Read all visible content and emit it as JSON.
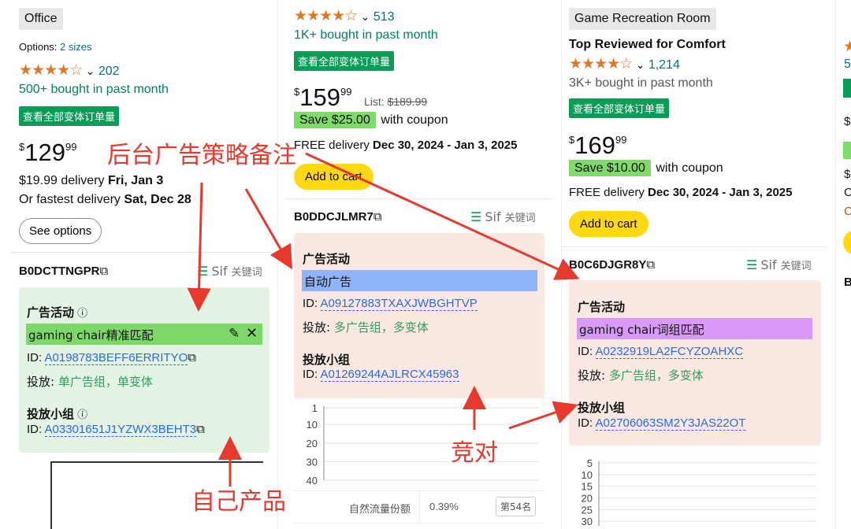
{
  "col1": {
    "category": "Office",
    "options_prefix": "Options:",
    "options_link": "2 sizes",
    "rating_count": "202",
    "bought": "500+ bought in past month",
    "variant_badge": "查看全部变体订单量",
    "price_sym": "$",
    "price_whole": "129",
    "price_frac": "99",
    "delivery_prefix": "$19.99 delivery",
    "delivery_date": "Fri, Jan 3",
    "fastest_prefix": "Or fastest delivery",
    "fastest_date": "Sat, Dec 28",
    "see_options": "See options",
    "asin": "B0DCTTNGPR",
    "sif_label": "Sif",
    "keyword_label": "关键词",
    "ad_activity_label": "广告活动",
    "campaign_name": "gaming chair精准匹配",
    "id_label": "ID:",
    "campaign_id": "A0198783BEFF6ERRITYO",
    "placement_label": "投放:",
    "placement_value": "单广告组，单变体",
    "ad_group_label": "投放小组",
    "ad_group_id": "A03301651J1YZWX3BEHT3"
  },
  "col2": {
    "rating_count": "513",
    "bought": "1K+ bought in past month",
    "variant_badge": "查看全部变体订单量",
    "price_sym": "$",
    "price_whole": "159",
    "price_frac": "99",
    "list_label": "List:",
    "list_price": "$189.99",
    "save_label": "Save $25.00",
    "coupon_text": "with coupon",
    "free_delivery": "FREE delivery",
    "delivery_range": "Dec 30, 2024 - Jan 3, 2025",
    "add_to_cart": "Add to cart",
    "asin": "B0DDCJLMR7",
    "sif_label": "Sif",
    "keyword_label": "关键词",
    "ad_activity_label": "广告活动",
    "campaign_name": "自动广告",
    "id_label": "ID:",
    "campaign_id": "A09127883TXAXJWBGHTVP",
    "placement_label": "投放:",
    "placement_value": "多广告组，多变体",
    "ad_group_label": "投放小组",
    "ad_group_id": "A01269244AJLRCX45963",
    "organic_label": "自然流量份额",
    "organic_value": "0.39%",
    "rank_badge": "第54名"
  },
  "col3": {
    "category": "Game Recreation Room",
    "top_reviewed": "Top Reviewed for Comfort",
    "rating_count": "1,214",
    "bought": "3K+ bought in past month",
    "variant_badge": "查看全部变体订单量",
    "price_sym": "$",
    "price_whole": "169",
    "price_frac": "99",
    "save_label": "Save $10.00",
    "coupon_text": "with coupon",
    "free_delivery": "FREE delivery",
    "delivery_range": "Dec 30, 2024 - Jan 3, 2025",
    "add_to_cart": "Add to cart",
    "asin": "B0C6DJGR8Y",
    "sif_label": "Sif",
    "keyword_label": "关键词",
    "ad_activity_label": "广告活动",
    "campaign_name": "gaming chair词组匹配",
    "id_label": "ID:",
    "campaign_id": "A0232919LA2FCYZOAHXC",
    "placement_label": "投放:",
    "placement_value": "多广告组，多变体",
    "ad_group_label": "投放小组",
    "ad_group_id": "A02706063SM2Y3JAS22OT"
  },
  "col4": {
    "rating_partial": "5",
    "price_partial": "$"
  },
  "annotations": {
    "backend_note": "后台广告策略备注",
    "own_product": "自己产品",
    "competitor": "竞对"
  },
  "chart2": {
    "y_ticks": [
      "1",
      "10",
      "20",
      "30",
      "40"
    ],
    "ylim": [
      1,
      40
    ]
  },
  "chart3": {
    "y_ticks": [
      "5",
      "10",
      "15",
      "20",
      "25",
      "30"
    ],
    "ylim": [
      5,
      32
    ]
  },
  "colors": {
    "own_panel": "#e3f3e4",
    "competitor_panel": "#fbe8e2",
    "auto_tag": "#90b4f9",
    "phrase_tag": "#d99af6",
    "exact_tag": "#7ed868",
    "annotation": "#e63a2e"
  }
}
